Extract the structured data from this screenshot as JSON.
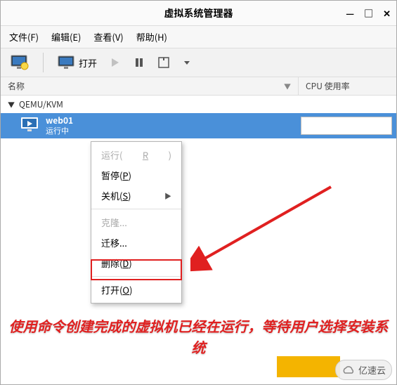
{
  "window": {
    "title": "虚拟系统管理器"
  },
  "menubar": {
    "file": "文件(F)",
    "edit": "编辑(E)",
    "view": "查看(V)",
    "help": "帮助(H)"
  },
  "toolbar": {
    "open": "打开"
  },
  "columns": {
    "name": "名称",
    "cpu": "CPU 使用率"
  },
  "tree": {
    "connection": "QEMU/KVM",
    "vm": {
      "name": "web01",
      "state": "运行中"
    }
  },
  "context_menu": {
    "run": "运行(R)",
    "pause": "暂停(P)",
    "shutdown": "关机(S)",
    "clone": "克隆...",
    "migrate": "迁移...",
    "delete": "删除(D)",
    "open": "打开(O)"
  },
  "annotation": {
    "caption": "使用命令创建完成的虚拟机已经在运行，等待用户选择安装系统",
    "highlight_target": "ctx-open"
  },
  "watermark": {
    "text": "亿速云"
  }
}
